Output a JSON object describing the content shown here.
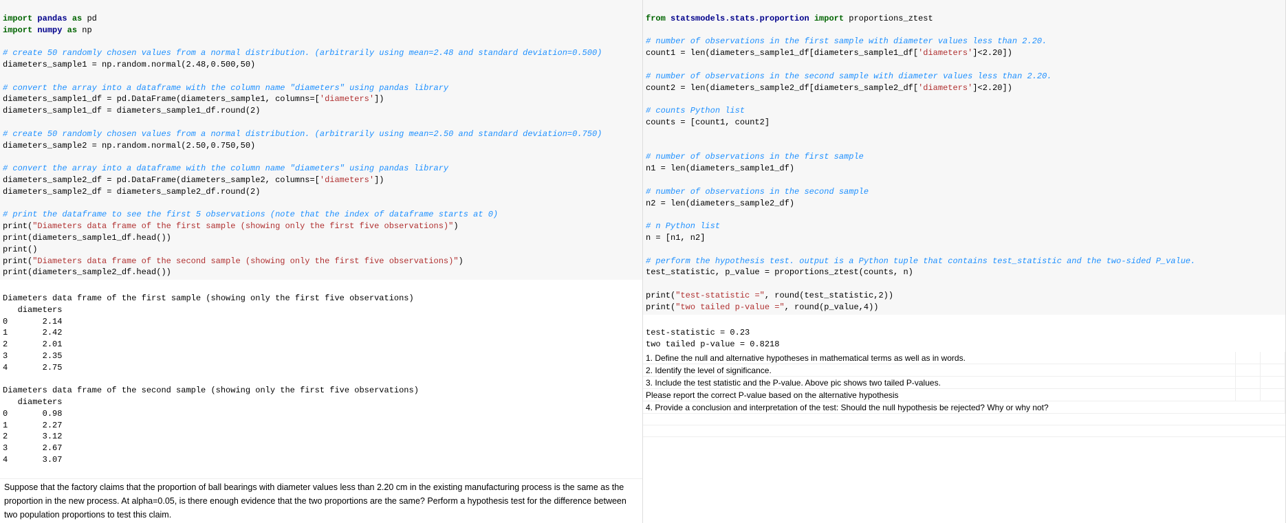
{
  "left": {
    "code": {
      "l1a": "import",
      "l1b": "pandas",
      "l1c": "as",
      "l1d": "pd",
      "l2a": "import",
      "l2b": "numpy",
      "l2c": "as",
      "l2d": "np",
      "c1": "# create 50 randomly chosen values from a normal distribution. (arbitrarily using mean=2.48 and standard deviation=0.500)",
      "l3": "diameters_sample1 = np.random.normal(2.48,0.500,50)",
      "c2": "# convert the array into a dataframe with the column name \"diameters\" using pandas library",
      "l4a": "diameters_sample1_df = pd.DataFrame(diameters_sample1, columns=[",
      "l4b": "'diameters'",
      "l4c": "])",
      "l5": "diameters_sample1_df = diameters_sample1_df.round(2)",
      "c3": "# create 50 randomly chosen values from a normal distribution. (arbitrarily using mean=2.50 and standard deviation=0.750)",
      "l6": "diameters_sample2 = np.random.normal(2.50,0.750,50)",
      "c4": "# convert the array into a dataframe with the column name \"diameters\" using pandas library",
      "l7a": "diameters_sample2_df = pd.DataFrame(diameters_sample2, columns=[",
      "l7b": "'diameters'",
      "l7c": "])",
      "l8": "diameters_sample2_df = diameters_sample2_df.round(2)",
      "c5": "# print the dataframe to see the first 5 observations (note that the index of dataframe starts at 0)",
      "l9a": "print(",
      "l9b": "\"Diameters data frame of the first sample (showing only the first five observations)\"",
      "l9c": ")",
      "l10": "print(diameters_sample1_df.head())",
      "l11": "print()",
      "l12a": "print(",
      "l12b": "\"Diameters data frame of the second sample (showing only the first five observations)\"",
      "l12c": ")",
      "l13": "print(diameters_sample2_df.head())"
    },
    "output": {
      "h1": "Diameters data frame of the first sample (showing only the first five observations)",
      "colhdr": "   diameters",
      "r1": [
        "0",
        "      2.14"
      ],
      "r2": [
        "1",
        "      2.42"
      ],
      "r3": [
        "2",
        "      2.01"
      ],
      "r4": [
        "3",
        "      2.35"
      ],
      "r5": [
        "4",
        "      2.75"
      ],
      "h2": "Diameters data frame of the second sample (showing only the first five observations)",
      "colhdr2": "   diameters",
      "s1": [
        "0",
        "      0.98"
      ],
      "s2": [
        "1",
        "      2.27"
      ],
      "s3": [
        "2",
        "      3.12"
      ],
      "s4": [
        "3",
        "      2.67"
      ],
      "s5": [
        "4",
        "      3.07"
      ]
    },
    "question": "Suppose that the factory claims that the proportion of ball bearings with diameter values less than 2.20 cm in the existing manufacturing process is the same as the proportion in the new process. At alpha=0.05, is there enough evidence that the two proportions are the same? Perform a hypothesis test for the difference between two population proportions to test this claim."
  },
  "right": {
    "code": {
      "l1a": "from",
      "l1b": "statsmodels.stats.proportion",
      "l1c": "import",
      "l1d": "proportions_ztest",
      "c1": "# number of observations in the first sample with diameter values less than 2.20.",
      "l2a": "count1 = len(diameters_sample1_df[diameters_sample1_df[",
      "l2b": "'diameters'",
      "l2c": "]<2.20])",
      "c2": "# number of observations in the second sample with diameter values less than 2.20.",
      "l3a": "count2 = len(diameters_sample2_df[diameters_sample2_df[",
      "l3b": "'diameters'",
      "l3c": "]<2.20])",
      "c3": "# counts Python list",
      "l4": "counts = [count1, count2]",
      "c4": "# number of observations in the first sample",
      "l5": "n1 = len(diameters_sample1_df)",
      "c5": "# number of observations in the second sample",
      "l6": "n2 = len(diameters_sample2_df)",
      "c6": "# n Python list",
      "l7": "n = [n1, n2]",
      "c7": "# perform the hypothesis test. output is a Python tuple that contains test_statistic and the two-sided P_value.",
      "l8": "test_statistic, p_value = proportions_ztest(counts, n)",
      "l9a": "print(",
      "l9b": "\"test-statistic =\"",
      "l9c": ", round(test_statistic,2))",
      "l10a": "print(",
      "l10b": "\"two tailed p-value =\"",
      "l10c": ", round(p_value,4))"
    },
    "output": {
      "o1": "test-statistic = 0.23",
      "o2": "two tailed p-value = 0.8218"
    },
    "tasks": [
      "1. Define the null and alternative hypotheses in mathematical terms as well as in words.",
      "2. Identify the level of significance.",
      "3. Include the test statistic and the P-value. Above pic shows two tailed P-values.",
      "    Please report the correct P-value based on the alternative hypothesis",
      "4. Provide a conclusion and interpretation of the test: Should the null hypothesis be rejected? Why or why not?"
    ]
  }
}
